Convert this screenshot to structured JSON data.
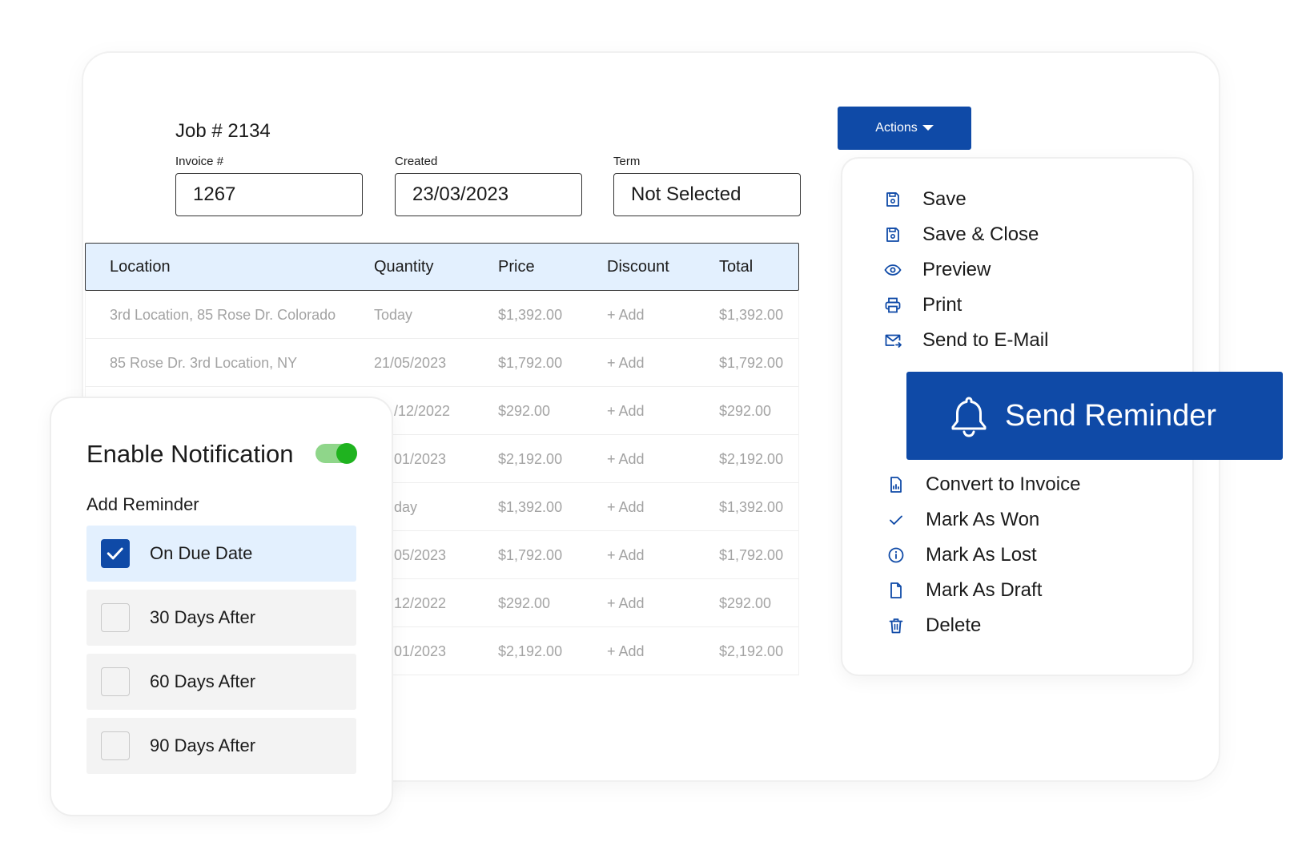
{
  "job": {
    "title": "Job # 2134",
    "invoice_label": "Invoice #",
    "invoice_value": "1267",
    "created_label": "Created",
    "created_value": "23/03/2023",
    "term_label": "Term",
    "term_value": "Not Selected"
  },
  "table": {
    "headers": [
      "Location",
      "Quantity",
      "Price",
      "Discount",
      "Total"
    ],
    "rows": [
      {
        "location": "3rd Location, 85 Rose Dr. Colorado",
        "quantity": "Today",
        "price": "$1,392.00",
        "discount": "+ Add",
        "total": "$1,392.00"
      },
      {
        "location": "85 Rose Dr. 3rd Location, NY",
        "quantity": "21/05/2023",
        "price": "$1,792.00",
        "discount": "+ Add",
        "total": "$1,792.00"
      },
      {
        "location": "",
        "quantity": "/12/2022",
        "price": "$292.00",
        "discount": "+ Add",
        "total": "$292.00"
      },
      {
        "location": "",
        "quantity": "01/2023",
        "price": "$2,192.00",
        "discount": "+ Add",
        "total": "$2,192.00"
      },
      {
        "location": "",
        "quantity": "day",
        "price": "$1,392.00",
        "discount": "+ Add",
        "total": "$1,392.00"
      },
      {
        "location": "",
        "quantity": "05/2023",
        "price": "$1,792.00",
        "discount": "+ Add",
        "total": "$1,792.00"
      },
      {
        "location": "",
        "quantity": "12/2022",
        "price": "$292.00",
        "discount": "+ Add",
        "total": "$292.00"
      },
      {
        "location": "",
        "quantity": "01/2023",
        "price": "$2,192.00",
        "discount": "+ Add",
        "total": "$2,192.00"
      }
    ]
  },
  "notification": {
    "title": "Enable Notification",
    "enabled": true,
    "add_reminder_label": "Add Reminder",
    "options": [
      {
        "label": "On Due Date",
        "checked": true
      },
      {
        "label": "30 Days After",
        "checked": false
      },
      {
        "label": "60 Days After",
        "checked": false
      },
      {
        "label": "90 Days After",
        "checked": false
      }
    ]
  },
  "actions": {
    "button_label": "Actions",
    "menu": [
      {
        "label": "Save",
        "icon": "save-icon"
      },
      {
        "label": "Save & Close",
        "icon": "save-close-icon"
      },
      {
        "label": "Preview",
        "icon": "eye-icon"
      },
      {
        "label": "Print",
        "icon": "printer-icon"
      },
      {
        "label": "Send to E-Mail",
        "icon": "mail-send-icon"
      }
    ],
    "reminder_label": "Send Reminder",
    "reminder_icon": "bell-icon",
    "menu_lower": [
      {
        "label": "Convert to Invoice",
        "icon": "invoice-icon"
      },
      {
        "label": "Mark As Won",
        "icon": "check-icon"
      },
      {
        "label": "Mark As Lost",
        "icon": "info-icon"
      },
      {
        "label": "Mark As Draft",
        "icon": "file-icon"
      },
      {
        "label": "Delete",
        "icon": "trash-icon"
      }
    ]
  },
  "colors": {
    "primary": "#0f4aa7",
    "header_bg": "#e3f0fe",
    "toggle_on": "#1fb31f",
    "muted_text": "#a3a3a3"
  }
}
